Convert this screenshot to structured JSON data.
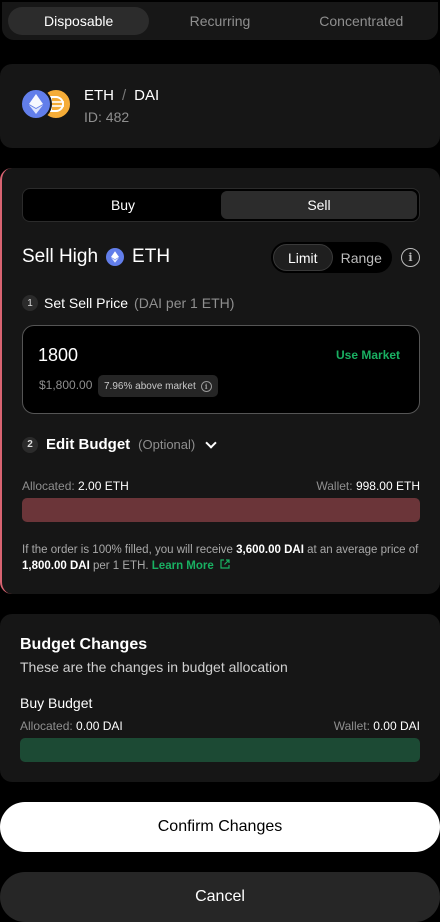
{
  "strategy_tabs": [
    {
      "label": "Disposable",
      "active": true
    },
    {
      "label": "Recurring",
      "active": false
    },
    {
      "label": "Concentrated",
      "active": false
    }
  ],
  "pair": {
    "base": "ETH",
    "separator": "/",
    "quote": "DAI",
    "id_text": "ID: 482",
    "icons": [
      "eth-icon",
      "dai-icon"
    ]
  },
  "order": {
    "side_tabs": [
      {
        "label": "Buy",
        "active": false
      },
      {
        "label": "Sell",
        "active": true
      }
    ],
    "heading": "Sell High",
    "token": "ETH",
    "mode_tabs": [
      {
        "label": "Limit",
        "active": true
      },
      {
        "label": "Range",
        "active": false
      }
    ],
    "step1": {
      "number": "1",
      "label": "Set Sell Price",
      "unit": "(DAI per 1 ETH)"
    },
    "price": {
      "value": "1800",
      "use_market": "Use Market",
      "usd": "$1,800.00",
      "market_diff": "7.96% above market"
    },
    "step2": {
      "number": "2",
      "label": "Edit Budget",
      "optional": "(Optional)"
    },
    "budget": {
      "allocated_label": "Allocated:",
      "allocated_value": "2.00 ETH",
      "wallet_label": "Wallet:",
      "wallet_value": "998.00 ETH",
      "allocated_fraction": 0.002
    },
    "note": {
      "part1": "If the order is 100% filled, you will receive",
      "receive": "3,600.00 DAI",
      "part2": "at an average price of",
      "avg_price": "1,800.00 DAI",
      "part3": "per 1 ETH.",
      "learn_more": "Learn More"
    }
  },
  "budget_changes": {
    "title": "Budget Changes",
    "subtitle": "These are the changes in budget allocation",
    "buy_budget": {
      "label": "Buy Budget",
      "allocated_label": "Allocated:",
      "allocated_value": "0.00 DAI",
      "wallet_label": "Wallet:",
      "wallet_value": "0.00 DAI"
    }
  },
  "actions": {
    "confirm": "Confirm Changes",
    "cancel": "Cancel"
  },
  "colors": {
    "background": "#000000",
    "card": "#161616",
    "accent_green": "#19b062",
    "sell_red": "#d86371",
    "sell_bar": "#6b3539",
    "buy_bar": "#1c4a34",
    "eth_blue": "#627eea",
    "dai_orange": "#f5ac37"
  }
}
